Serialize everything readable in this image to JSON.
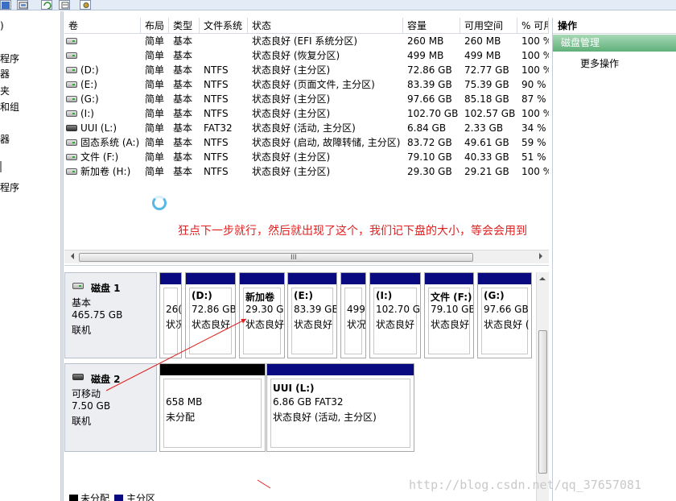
{
  "tree": {
    "items": [
      ")",
      "程序",
      "器",
      "夹",
      "和组",
      "",
      "器",
      "",
      "程序"
    ]
  },
  "columns": [
    "卷",
    "布局",
    "类型",
    "文件系统",
    "状态",
    "容量",
    "可用空间",
    "% 可用"
  ],
  "volumes": [
    {
      "name": "",
      "layout": "简单",
      "type": "基本",
      "fs": "",
      "status": "状态良好 (EFI 系统分区)",
      "capacity": "260 MB",
      "free": "260 MB",
      "pct": "100 %"
    },
    {
      "name": "",
      "layout": "简单",
      "type": "基本",
      "fs": "",
      "status": "状态良好 (恢复分区)",
      "capacity": "499 MB",
      "free": "499 MB",
      "pct": "100 %"
    },
    {
      "name": "(D:)",
      "layout": "简单",
      "type": "基本",
      "fs": "NTFS",
      "status": "状态良好 (主分区)",
      "capacity": "72.86 GB",
      "free": "72.77 GB",
      "pct": "100 %"
    },
    {
      "name": "(E:)",
      "layout": "简单",
      "type": "基本",
      "fs": "NTFS",
      "status": "状态良好 (页面文件, 主分区)",
      "capacity": "83.39 GB",
      "free": "75.39 GB",
      "pct": "90 %"
    },
    {
      "name": "(G:)",
      "layout": "简单",
      "type": "基本",
      "fs": "NTFS",
      "status": "状态良好 (主分区)",
      "capacity": "97.66 GB",
      "free": "85.18 GB",
      "pct": "87 %"
    },
    {
      "name": "(I:)",
      "layout": "简单",
      "type": "基本",
      "fs": "NTFS",
      "status": "状态良好 (主分区)",
      "capacity": "102.70 GB",
      "free": "102.57 GB",
      "pct": "100 %"
    },
    {
      "name": "UUI (L:)",
      "layout": "简单",
      "type": "基本",
      "fs": "FAT32",
      "status": "状态良好 (活动, 主分区)",
      "capacity": "6.84 GB",
      "free": "2.33 GB",
      "pct": "34 %"
    },
    {
      "name": "固态系统 (A:)",
      "layout": "简单",
      "type": "基本",
      "fs": "NTFS",
      "status": "状态良好 (启动, 故障转储, 主分区)",
      "capacity": "83.72 GB",
      "free": "49.61 GB",
      "pct": "59 %"
    },
    {
      "name": "文件 (F:)",
      "layout": "简单",
      "type": "基本",
      "fs": "NTFS",
      "status": "状态良好 (主分区)",
      "capacity": "79.10 GB",
      "free": "40.33 GB",
      "pct": "51 %"
    },
    {
      "name": "新加卷 (H:)",
      "layout": "简单",
      "type": "基本",
      "fs": "NTFS",
      "status": "状态良好 (主分区)",
      "capacity": "29.30 GB",
      "free": "29.21 GB",
      "pct": "100 %"
    }
  ],
  "hscroll_grip": "III",
  "annotation": "狂点下一步就行，然后就出现了这个，我们记下盘的大小，等会会用到",
  "disks": [
    {
      "title": "磁盘 1",
      "kind": "基本",
      "size": "465.75 GB",
      "state": "联机",
      "partitions": [
        {
          "name": "",
          "size": "26(",
          "status": "状况"
        },
        {
          "name": "(D:)",
          "size": "72.86 GB",
          "status": "状态良好"
        },
        {
          "name": "新加卷",
          "size": "29.30 G",
          "status": "状态良好"
        },
        {
          "name": "(E:)",
          "size": "83.39 GB",
          "status": "状态良好"
        },
        {
          "name": "",
          "size": "499",
          "status": "状况"
        },
        {
          "name": "(I:)",
          "size": "102.70 G",
          "status": "状态良好"
        },
        {
          "name": "文件 (F:)",
          "size": "79.10 GB",
          "status": "状态良好"
        },
        {
          "name": "(G:)",
          "size": "97.66 GB",
          "status": "状态良好 ("
        }
      ]
    },
    {
      "title": "磁盘 2",
      "kind": "可移动",
      "size": "7.50 GB",
      "state": "联机",
      "partitions": [
        {
          "name": "",
          "size": "658 MB",
          "status": "未分配"
        },
        {
          "name": "UUI  (L:)",
          "size": "6.86 GB FAT32",
          "status": "状态良好 (活动, 主分区)"
        }
      ]
    }
  ],
  "legend": {
    "unallocated": "未分配",
    "primary": "主分区"
  },
  "actions": {
    "header": "操作",
    "section": "磁盘管理",
    "more": "更多操作"
  },
  "watermark": "http://blog.csdn.net/qq_37657081",
  "colors": {
    "partition_bar": "#0a0a80",
    "unallocated_bar": "#000000",
    "annotation": "#e02020",
    "action_section": "#5fb07a"
  }
}
